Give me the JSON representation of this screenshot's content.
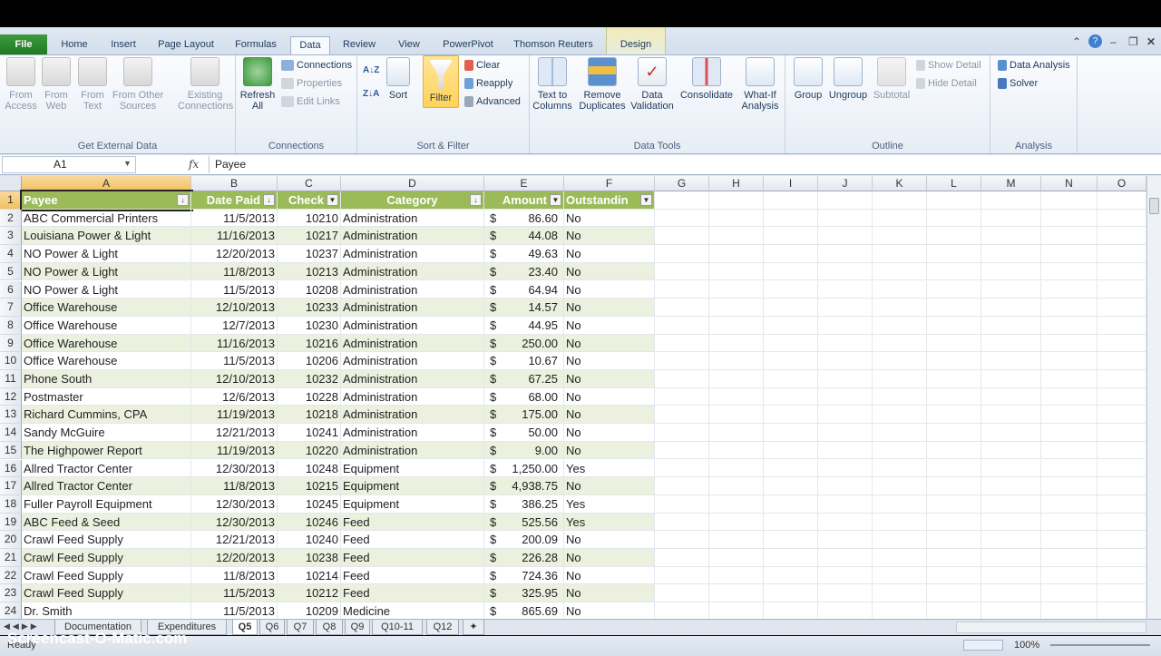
{
  "ribbon": {
    "file_tab": "File",
    "tabs": [
      "Home",
      "Insert",
      "Page Layout",
      "Formulas",
      "Data",
      "Review",
      "View",
      "PowerPivot",
      "Thomson Reuters",
      "Design"
    ],
    "groups": {
      "get_external": {
        "label": "Get External Data",
        "from_access": "From\nAccess",
        "from_web": "From\nWeb",
        "from_text": "From\nText",
        "from_other": "From Other\nSources",
        "existing": "Existing\nConnections"
      },
      "connections": {
        "label": "Connections",
        "refresh": "Refresh\nAll",
        "connections": "Connections",
        "properties": "Properties",
        "edit_links": "Edit Links"
      },
      "sort_filter": {
        "label": "Sort & Filter",
        "sort": "Sort",
        "filter": "Filter",
        "clear": "Clear",
        "reapply": "Reapply",
        "advanced": "Advanced"
      },
      "data_tools": {
        "label": "Data Tools",
        "text_to_columns": "Text to\nColumns",
        "remove_dup": "Remove\nDuplicates",
        "data_validation": "Data\nValidation",
        "consolidate": "Consolidate",
        "what_if": "What-If\nAnalysis"
      },
      "outline": {
        "label": "Outline",
        "group": "Group",
        "ungroup": "Ungroup",
        "subtotal": "Subtotal",
        "show_detail": "Show Detail",
        "hide_detail": "Hide Detail"
      },
      "analysis": {
        "label": "Analysis",
        "data_analysis": "Data Analysis",
        "solver": "Solver"
      }
    }
  },
  "formula_bar": {
    "name_box": "A1",
    "fx": "fx",
    "content": "Payee"
  },
  "columns": [
    "A",
    "B",
    "C",
    "D",
    "E",
    "F",
    "G",
    "H",
    "I",
    "J",
    "K",
    "L",
    "M",
    "N",
    "O"
  ],
  "headers": [
    "Payee",
    "Date Paid",
    "Check",
    "Category",
    "Amount",
    "Outstandin"
  ],
  "rows": [
    [
      "ABC Commercial Printers",
      "11/5/2013",
      "10210",
      "Administration",
      "$",
      "86.60",
      "No"
    ],
    [
      "Louisiana Power & Light",
      "11/16/2013",
      "10217",
      "Administration",
      "$",
      "44.08",
      "No"
    ],
    [
      "NO Power & Light",
      "12/20/2013",
      "10237",
      "Administration",
      "$",
      "49.63",
      "No"
    ],
    [
      "NO Power & Light",
      "11/8/2013",
      "10213",
      "Administration",
      "$",
      "23.40",
      "No"
    ],
    [
      "NO Power & Light",
      "11/5/2013",
      "10208",
      "Administration",
      "$",
      "64.94",
      "No"
    ],
    [
      "Office Warehouse",
      "12/10/2013",
      "10233",
      "Administration",
      "$",
      "14.57",
      "No"
    ],
    [
      "Office Warehouse",
      "12/7/2013",
      "10230",
      "Administration",
      "$",
      "44.95",
      "No"
    ],
    [
      "Office Warehouse",
      "11/16/2013",
      "10216",
      "Administration",
      "$",
      "250.00",
      "No"
    ],
    [
      "Office Warehouse",
      "11/5/2013",
      "10206",
      "Administration",
      "$",
      "10.67",
      "No"
    ],
    [
      "Phone South",
      "12/10/2013",
      "10232",
      "Administration",
      "$",
      "67.25",
      "No"
    ],
    [
      "Postmaster",
      "12/6/2013",
      "10228",
      "Administration",
      "$",
      "68.00",
      "No"
    ],
    [
      "Richard Cummins, CPA",
      "11/19/2013",
      "10218",
      "Administration",
      "$",
      "175.00",
      "No"
    ],
    [
      "Sandy McGuire",
      "12/21/2013",
      "10241",
      "Administration",
      "$",
      "50.00",
      "No"
    ],
    [
      "The Highpower Report",
      "11/19/2013",
      "10220",
      "Administration",
      "$",
      "9.00",
      "No"
    ],
    [
      "Allred Tractor Center",
      "12/30/2013",
      "10248",
      "Equipment",
      "$",
      "1,250.00",
      "Yes"
    ],
    [
      "Allred Tractor Center",
      "11/8/2013",
      "10215",
      "Equipment",
      "$",
      "4,938.75",
      "No"
    ],
    [
      "Fuller Payroll Equipment",
      "12/30/2013",
      "10245",
      "Equipment",
      "$",
      "386.25",
      "Yes"
    ],
    [
      "ABC Feed & Seed",
      "12/30/2013",
      "10246",
      "Feed",
      "$",
      "525.56",
      "Yes"
    ],
    [
      "Crawl Feed Supply",
      "12/21/2013",
      "10240",
      "Feed",
      "$",
      "200.09",
      "No"
    ],
    [
      "Crawl Feed Supply",
      "12/20/2013",
      "10238",
      "Feed",
      "$",
      "226.28",
      "No"
    ],
    [
      "Crawl Feed Supply",
      "11/8/2013",
      "10214",
      "Feed",
      "$",
      "724.36",
      "No"
    ],
    [
      "Crawl Feed Supply",
      "11/5/2013",
      "10212",
      "Feed",
      "$",
      "325.95",
      "No"
    ],
    [
      "Dr. Smith",
      "11/5/2013",
      "10209",
      "Medicine",
      "$",
      "865.69",
      "No"
    ]
  ],
  "sheet_tabs": [
    "Documentation",
    "Expenditures",
    "Q5",
    "Q6",
    "Q7",
    "Q8",
    "Q9",
    "Q10-11",
    "Q12"
  ],
  "active_sheet": "Q5",
  "status": {
    "ready": "Ready",
    "zoom": "100%"
  },
  "watermark": "Screencast-O-Matic.com",
  "colors": {
    "header_green": "#9bbb59",
    "band": "#ebf1de",
    "file_tab": "#2a8a2d"
  }
}
